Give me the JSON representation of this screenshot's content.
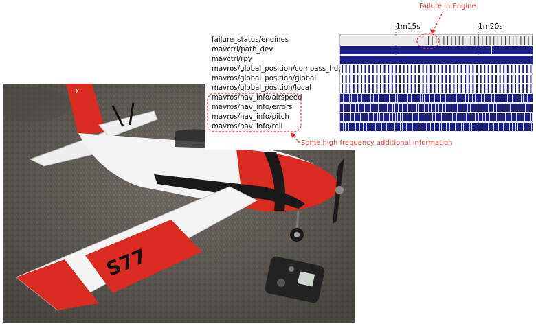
{
  "timeline": {
    "ticks": [
      "1m15s",
      "1m20s"
    ],
    "topics": [
      {
        "name": "failure_status/engines"
      },
      {
        "name": "mavctrl/path_dev"
      },
      {
        "name": "mavctrl/rpy"
      },
      {
        "name": "mavros/global_position/compass_hdg"
      },
      {
        "name": "mavros/global_position/global"
      },
      {
        "name": "mavros/global_position/local"
      },
      {
        "name": "mavros/nav_info/airspeed"
      },
      {
        "name": "mavros/nav_info/errors"
      },
      {
        "name": "mavros/nav_info/pitch"
      },
      {
        "name": "mavros/nav_info/roll"
      }
    ]
  },
  "annotations": {
    "engine_failure": "Failure in Engine",
    "high_frequency": "Some high frequency additional information"
  },
  "photo": {
    "aircraft_marking": "S77"
  },
  "colors": {
    "message_bar": "#1a1f8a",
    "annotation": "#e03030",
    "fuselage_red": "#d92b20"
  }
}
